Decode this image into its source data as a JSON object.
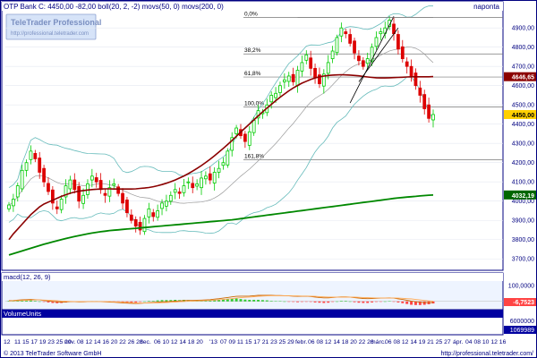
{
  "header": {
    "title": "OTP Bank C: 4450,00 -82,00 boll(20, 2, -2) movs(50, 0) movs(200, 0)",
    "period": "napontа"
  },
  "watermark": {
    "brand": "TeleTrader Professional",
    "url": "http://professional.teletrader.com"
  },
  "footer": {
    "copyright": "© 2013 TeleTrader Software GmbH",
    "url": "http://professional.teletrader.com/"
  },
  "colors": {
    "frame": "#0000a0",
    "panel_bg": "#eef4ff",
    "price_up": "#00cc00",
    "price_down": "#dd0000",
    "ma50": "#8b0000",
    "ma200": "#008800",
    "bollinger": "#66bbbb",
    "fib_line": "#777777",
    "macd": "#cc6600",
    "signal": "#ffaa55",
    "hist_pos": "#33cc33",
    "hist_neg": "#ff4444",
    "label_gold": "#ffd000"
  },
  "chart_data": [
    {
      "type": "candlestick",
      "title": "OTP Bank C: 4450,00 -82,00 boll(20, 2, -2) movs(50, 0) movs(200, 0)",
      "y_ticks": [
        "4900,00",
        "4800,00",
        "4700,00",
        "4600,00",
        "4500,00",
        "4400,00",
        "4300,00",
        "4200,00",
        "4100,00",
        "4000,00",
        "3900,00",
        "3800,00",
        "3700,00"
      ],
      "ylim": [
        3650,
        4980
      ],
      "price_label": "4450,00",
      "ma50_label": "4646,65",
      "ma200_label": "4032,19",
      "fib_levels": [
        {
          "label": "0,0%",
          "value": 4955
        },
        {
          "label": "38,2%",
          "value": 4765
        },
        {
          "label": "61,8%",
          "value": 4645
        },
        {
          "label": "100,0%",
          "value": 4490
        },
        {
          "label": "161,8%",
          "value": 4215
        }
      ],
      "closes": [
        3980,
        4010,
        4080,
        4160,
        4200,
        4260,
        4220,
        4150,
        4100,
        4050,
        3990,
        3960,
        4010,
        4080,
        4110,
        4060,
        4000,
        4030,
        4090,
        4130,
        4100,
        4060,
        4030,
        4070,
        4090,
        4040,
        3990,
        3940,
        3900,
        3870,
        3850,
        3910,
        3960,
        3920,
        3950,
        3990,
        4000,
        4030,
        4060,
        4040,
        4080,
        4100,
        4070,
        4090,
        4120,
        4130,
        4110,
        4150,
        4170,
        4200,
        4260,
        4330,
        4380,
        4340,
        4310,
        4360,
        4420,
        4470,
        4460,
        4500,
        4550,
        4560,
        4600,
        4630,
        4650,
        4620,
        4680,
        4720,
        4760,
        4690,
        4640,
        4610,
        4660,
        4720,
        4780,
        4850,
        4900,
        4870,
        4820,
        4770,
        4730,
        4700,
        4740,
        4800,
        4850,
        4880,
        4900,
        4940,
        4870,
        4790,
        4740,
        4700,
        4650,
        4600,
        4550,
        4480,
        4430,
        4450
      ],
      "ma50": [
        3800,
        3830,
        3855,
        3880,
        3905,
        3930,
        3950,
        3970,
        3985,
        3995,
        4005,
        4015,
        4025,
        4033,
        4041,
        4047,
        4052,
        4055,
        4058,
        4060,
        4062,
        4063,
        4064,
        4064,
        4063,
        4063,
        4063,
        4063,
        4063,
        4064,
        4066,
        4068,
        4071,
        4075,
        4080,
        4086,
        4093,
        4101,
        4110,
        4120,
        4131,
        4143,
        4156,
        4170,
        4185,
        4201,
        4218,
        4236,
        4255,
        4274,
        4294,
        4315,
        4337,
        4359,
        4380,
        4401,
        4422,
        4443,
        4464,
        4484,
        4503,
        4522,
        4540,
        4557,
        4573,
        4588,
        4601,
        4613,
        4623,
        4632,
        4640,
        4646,
        4650,
        4653,
        4655,
        4656,
        4657,
        4656,
        4655,
        4653,
        4651,
        4648,
        4645,
        4643,
        4641,
        4640,
        4640,
        4641,
        4642,
        4643,
        4644,
        4645,
        4646,
        4646,
        4646,
        4646,
        4646,
        4647
      ],
      "ma200": [
        3720,
        3727,
        3734,
        3741,
        3748,
        3755,
        3762,
        3769,
        3776,
        3782,
        3788,
        3794,
        3800,
        3806,
        3811,
        3816,
        3821,
        3826,
        3830,
        3834,
        3838,
        3841,
        3844,
        3847,
        3849,
        3851,
        3853,
        3855,
        3857,
        3859,
        3861,
        3863,
        3865,
        3867,
        3869,
        3871,
        3873,
        3875,
        3877,
        3879,
        3881,
        3883,
        3885,
        3887,
        3889,
        3891,
        3893,
        3895,
        3897,
        3899,
        3901,
        3903,
        3906,
        3909,
        3912,
        3915,
        3918,
        3921,
        3924,
        3927,
        3930,
        3933,
        3936,
        3939,
        3942,
        3945,
        3948,
        3951,
        3954,
        3957,
        3960,
        3963,
        3966,
        3969,
        3972,
        3975,
        3978,
        3981,
        3984,
        3987,
        3990,
        3993,
        3996,
        3999,
        4002,
        4005,
        4008,
        4011,
        4014,
        4017,
        4019,
        4021,
        4023,
        4025,
        4027,
        4029,
        4031,
        4032
      ]
    },
    {
      "type": "line",
      "title": "macd(12, 26, 9)",
      "y_ticks": [
        "100,0000",
        "0,0000"
      ],
      "ylim": [
        -40,
        120
      ],
      "value_label": "-6,7523",
      "macd": [
        5,
        6,
        8,
        10,
        11,
        12,
        11,
        9,
        6,
        3,
        0,
        -3,
        -4,
        -3,
        -2,
        -2,
        -3,
        -3,
        -2,
        -1,
        -1,
        -2,
        -3,
        -4,
        -5,
        -7,
        -9,
        -11,
        -12,
        -13,
        -12,
        -10,
        -8,
        -7,
        -5,
        -3,
        -2,
        0,
        2,
        3,
        5,
        6,
        6,
        7,
        8,
        9,
        11,
        14,
        17,
        20,
        24,
        28,
        31,
        32,
        32,
        33,
        35,
        37,
        38,
        38,
        37,
        36,
        36,
        35,
        34,
        32,
        31,
        31,
        32,
        30,
        27,
        24,
        22,
        22,
        24,
        26,
        28,
        28,
        26,
        23,
        20,
        18,
        17,
        18,
        19,
        20,
        21,
        22,
        20,
        16,
        12,
        7,
        2,
        -2,
        -5,
        -7,
        -8,
        -7
      ],
      "signal": [
        3,
        4,
        5,
        6,
        7,
        8,
        9,
        9,
        8,
        7,
        6,
        4,
        2,
        1,
        0,
        -1,
        -1,
        -2,
        -2,
        -2,
        -2,
        -2,
        -2,
        -2,
        -3,
        -4,
        -5,
        -6,
        -8,
        -9,
        -10,
        -10,
        -10,
        -9,
        -9,
        -8,
        -7,
        -5,
        -4,
        -2,
        -1,
        1,
        2,
        3,
        4,
        5,
        6,
        8,
        10,
        12,
        14,
        17,
        20,
        23,
        25,
        27,
        29,
        31,
        33,
        34,
        35,
        35,
        35,
        35,
        35,
        34,
        34,
        33,
        33,
        32,
        31,
        29,
        28,
        27,
        26,
        26,
        26,
        26,
        26,
        26,
        25,
        24,
        23,
        22,
        21,
        21,
        21,
        21,
        21,
        20,
        19,
        17,
        15,
        12,
        9,
        6,
        3,
        1
      ]
    },
    {
      "type": "bar",
      "title": "VolumeUnits",
      "y_ticks": [
        "6000000",
        "0"
      ],
      "ylim": [
        0,
        9000000
      ],
      "value_label": "1069989"
    }
  ],
  "x_axis": {
    "labels": [
      "12",
      "11 15 17 19 23 25 29",
      "nov.",
      "08 12 14 16 20 22 26 28",
      "dec.",
      "06 10 12 14 18 20",
      "'13",
      "07 09 11 15 17 21 23 25 29",
      "febr.",
      "06 08 12 14 18 20 22 26",
      "márc.",
      "06 08 12 14 19 21 25 27",
      "ápr.",
      "04 08 10 12 16"
    ]
  }
}
